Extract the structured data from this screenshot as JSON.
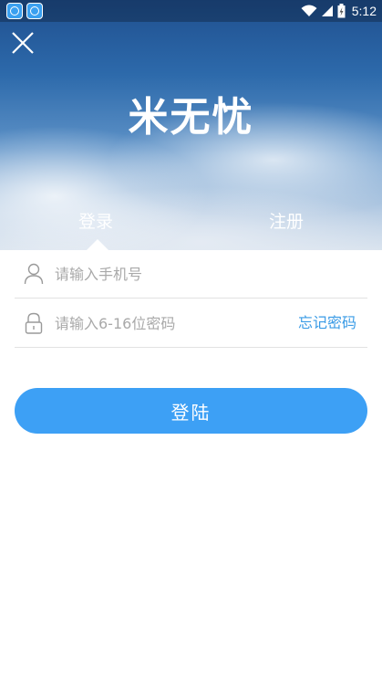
{
  "status_bar": {
    "notification_icons": [
      "app-notification-icon",
      "app-notification-icon"
    ],
    "system_icons": [
      "wifi-icon",
      "signal-icon",
      "battery-icon"
    ],
    "time": "5:12"
  },
  "header": {
    "close_icon": "close-icon",
    "title": "米无忧"
  },
  "tabs": {
    "login_label": "登录",
    "register_label": "注册",
    "active": "login"
  },
  "form": {
    "phone_icon": "user-icon",
    "phone_placeholder": "请输入手机号",
    "password_icon": "lock-icon",
    "password_placeholder": "请输入6-16位密码",
    "forgot_label": "忘记密码"
  },
  "login_button": {
    "label": "登陆"
  },
  "colors": {
    "accent": "#3da0f5",
    "link": "#3a9be6",
    "divider": "#e2e2e2",
    "placeholder": "#a9a9a9"
  }
}
